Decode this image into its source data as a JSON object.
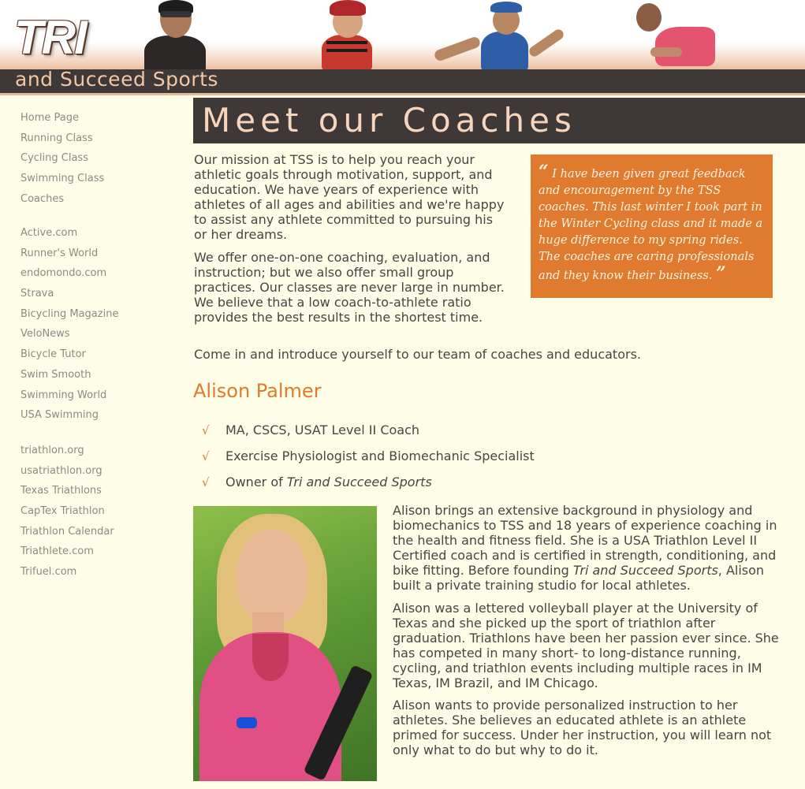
{
  "header": {
    "logo_main": "TRI",
    "logo_sub": "and Succeed Sports"
  },
  "sidebar": {
    "group1": [
      "Home Page",
      "Running Class",
      "Cycling Class",
      "Swimming Class",
      "Coaches"
    ],
    "group2": [
      "Active.com",
      "Runner's World",
      "endomondo.com",
      "Strava",
      "Bicycling Magazine",
      "VeloNews",
      "Bicycle Tutor",
      "Swim Smooth",
      "Swimming World",
      "USA Swimming"
    ],
    "group3": [
      "triathlon.org",
      "usatriathlon.org",
      "Texas Triathlons",
      "CapTex Triathlon",
      "Triathlon Calendar",
      "Triathlete.com",
      "Trifuel.com"
    ]
  },
  "main": {
    "title": "Meet our Coaches",
    "intro_p1": "Our mission at TSS is to help you reach your athletic goals through motivation, support, and education. We have years of experience with athletes of all ages and abilities and we're happy to assist any athlete committed to pursuing his or her dreams.",
    "intro_p2": "We offer one-on-one coaching, evaluation, and instruction; but we also offer small group practices. Our classes are never large in number. We believe that a low coach-to-athlete ratio provides the best results in the shortest time.",
    "intro_p3": "Come in and introduce yourself to our team of coaches and educators.",
    "quote": "I have been given great feedback and encouragement by the TSS coaches. This last winter I took part in the Winter Cycling class and it made a huge difference to my spring rides. The coaches are caring professionals and they know their business.",
    "quote_open": "“",
    "quote_close": "”",
    "coach": {
      "name": "Alison Palmer",
      "check_glyph": "√",
      "credentials": [
        "MA, CSCS, USAT Level II Coach",
        "Exercise Physiologist and Biomechanic Specialist"
      ],
      "credential3_prefix": "Owner of ",
      "credential3_italic": "Tri and Succeed Sports",
      "bio_p1_a": "Alison brings an extensive background in physiology and biomechanics to TSS and 18 years of experience coaching in the health and fitness field. She is a USA Triathlon Level II Certified coach and is certified in strength, conditioning, and bike fitting. Before founding ",
      "bio_p1_italic": "Tri and Succeed Sports",
      "bio_p1_b": ", Alison built a private training studio for local athletes.",
      "bio_p2": "Alison was a lettered volleyball player at the University of Texas and she picked up the sport of triathlon after graduation. Triathlons have been her passion ever since. She has competed in many short- to long-distance running, cycling, and triathlon events including multiple races in IM Texas, IM Brazil, and IM Chicago.",
      "bio_p3": "Alison wants to provide personalized instruction to her athletes. She believes an educated athlete is an athlete primed for success. Under her instruction, you will learn not only what to do but why to do it."
    }
  },
  "colors": {
    "accent": "#e07a2e",
    "dark_bar": "#3e3936",
    "background": "#fefde8",
    "nav_text": "#8e8a84"
  }
}
